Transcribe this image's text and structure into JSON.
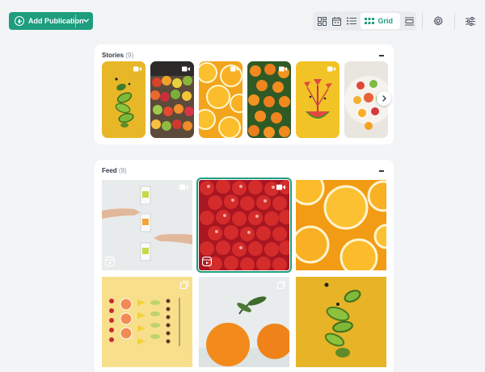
{
  "toolbar": {
    "add_label": "Add Publication",
    "grid_label": "Grid"
  },
  "stories": {
    "title": "Stories",
    "count": "(9)",
    "items": [
      {
        "theme": "kiwi",
        "media": "video-icon"
      },
      {
        "theme": "market",
        "media": "video-icon"
      },
      {
        "theme": "orange-slices",
        "media": "video-icon"
      },
      {
        "theme": "oranges",
        "media": "video-icon"
      },
      {
        "theme": "watermelon",
        "media": "video-icon"
      },
      {
        "theme": "fruit-bowl",
        "media": "none"
      }
    ]
  },
  "feed": {
    "title": "Feed",
    "count": "(9)",
    "items": [
      {
        "theme": "juice-boxes",
        "media": "video-icon",
        "reel": true,
        "selected": false
      },
      {
        "theme": "strawberries",
        "media": "video-icon",
        "reel": true,
        "selected": true
      },
      {
        "theme": "orange-slices",
        "media": "none",
        "reel": false,
        "selected": false
      },
      {
        "theme": "fruit-rows",
        "media": "carousel-icon",
        "reel": false,
        "selected": false
      },
      {
        "theme": "oranges-white",
        "media": "carousel-icon",
        "reel": false,
        "selected": false
      },
      {
        "theme": "kiwi",
        "media": "none",
        "reel": false,
        "selected": false
      }
    ]
  },
  "colors": {
    "accent": "#1e9e7e",
    "background": "#f3f4f6",
    "card": "#ffffff",
    "yellow": "#e9b824"
  }
}
